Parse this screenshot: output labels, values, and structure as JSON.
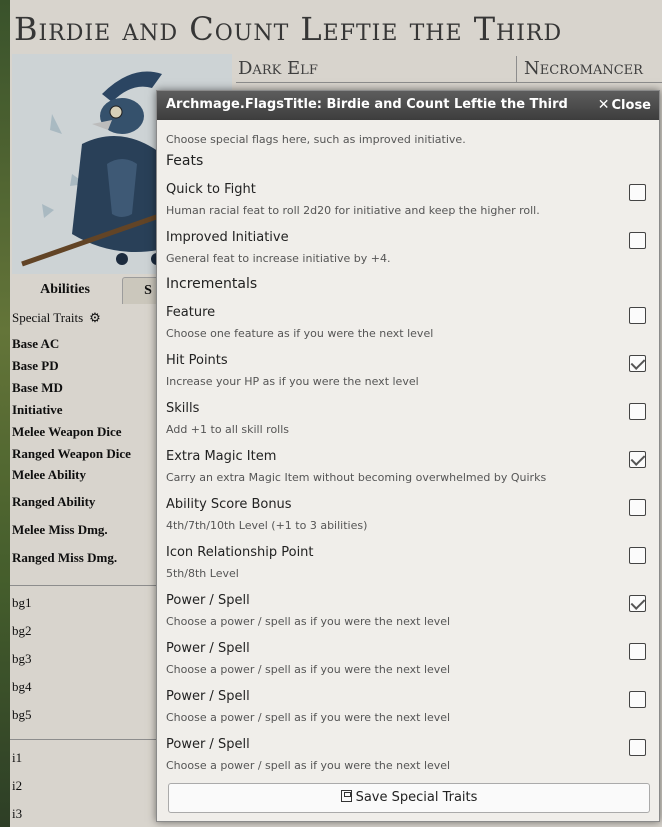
{
  "sheet": {
    "title": "Birdie and Count Leftie the Third",
    "race": "Dark Elf",
    "class": "Necromancer",
    "tabs": [
      "Abilities",
      "S"
    ],
    "special_traits_label": "Special Traits",
    "attributes": [
      "Base AC",
      "Base PD",
      "Base MD",
      "Initiative",
      "Melee Weapon Dice",
      "Ranged Weapon Dice",
      "Melee Ability",
      "Ranged Ability",
      "Melee Miss Dmg.",
      "Ranged Miss Dmg."
    ],
    "backgrounds": [
      "bg1",
      "bg2",
      "bg3",
      "bg4",
      "bg5"
    ],
    "items": [
      "i1",
      "i2",
      "i3"
    ]
  },
  "modal": {
    "title": "Archmage.FlagsTitle: Birdie and Count Leftie the Third",
    "close_label": "Close",
    "intro": "Choose special flags here, such as improved initiative.",
    "sections": [
      {
        "heading": "Feats",
        "flags": [
          {
            "label": "Quick to Fight",
            "hint": "Human racial feat to roll 2d20 for initiative and keep the higher roll.",
            "checked": false
          },
          {
            "label": "Improved Initiative",
            "hint": "General feat to increase initiative by +4.",
            "checked": false
          }
        ]
      },
      {
        "heading": "Incrementals",
        "flags": [
          {
            "label": "Feature",
            "hint": "Choose one feature as if you were the next level",
            "checked": false
          },
          {
            "label": "Hit Points",
            "hint": "Increase your HP as if you were the next level",
            "checked": true
          },
          {
            "label": "Skills",
            "hint": "Add +1 to all skill rolls",
            "checked": false
          },
          {
            "label": "Extra Magic Item",
            "hint": "Carry an extra Magic Item without becoming overwhelmed by Quirks",
            "checked": true
          },
          {
            "label": "Ability Score Bonus",
            "hint": "4th/7th/10th Level (+1 to 3 abilities)",
            "checked": false
          },
          {
            "label": "Icon Relationship Point",
            "hint": "5th/8th Level",
            "checked": false
          },
          {
            "label": "Power / Spell",
            "hint": "Choose a power / spell as if you were the next level",
            "checked": true
          },
          {
            "label": "Power / Spell",
            "hint": "Choose a power / spell as if you were the next level",
            "checked": false
          },
          {
            "label": "Power / Spell",
            "hint": "Choose a power / spell as if you were the next level",
            "checked": false
          },
          {
            "label": "Power / Spell",
            "hint": "Choose a power / spell as if you were the next level",
            "checked": false
          }
        ]
      }
    ],
    "save_label": "Save Special Traits"
  }
}
